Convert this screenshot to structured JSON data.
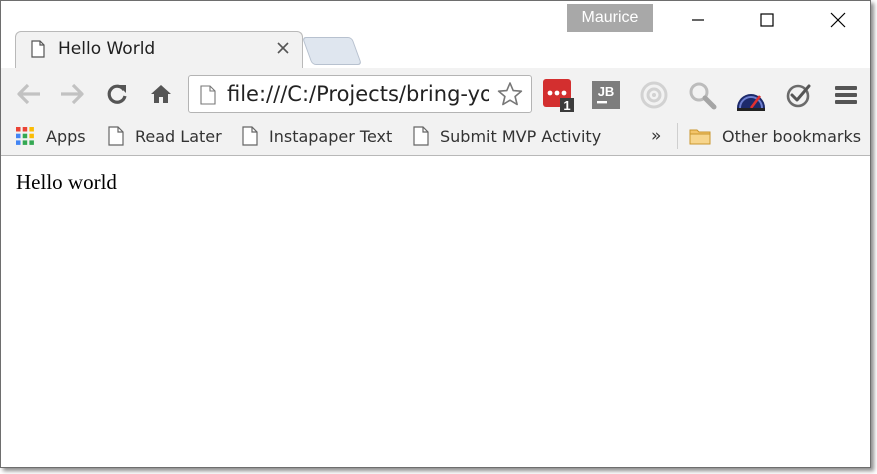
{
  "window": {
    "user": "Maurice",
    "controls": {
      "minimize": "minimize",
      "maximize": "maximize",
      "close": "close"
    }
  },
  "tab": {
    "title": "Hello World",
    "icon": "page-icon",
    "close_icon": "close-icon"
  },
  "toolbar": {
    "back_icon": "arrow-left-icon",
    "forward_icon": "arrow-right-icon",
    "reload_icon": "reload-icon",
    "home_icon": "home-icon",
    "address": "file:///C:/Projects/bring-your-own",
    "extensions": [
      {
        "name": "lastpass-icon",
        "badge": "1",
        "color": "#d32f2f"
      },
      {
        "name": "jetbrains-icon",
        "label": "JB"
      },
      {
        "name": "radar-icon"
      },
      {
        "name": "magnifier-icon"
      },
      {
        "name": "speedometer-icon"
      },
      {
        "name": "checkmark-icon"
      },
      {
        "name": "menu-icon"
      }
    ]
  },
  "bookmarks": {
    "apps": "Apps",
    "items": [
      "Read Later",
      "Instapaper Text",
      "Submit MVP Activity"
    ],
    "overflow": "»",
    "other": "Other bookmarks"
  },
  "page": {
    "text": "Hello world"
  },
  "colors": {
    "chrome_bg": "#f2f2f2",
    "user_badge": "#a8a8a8"
  }
}
